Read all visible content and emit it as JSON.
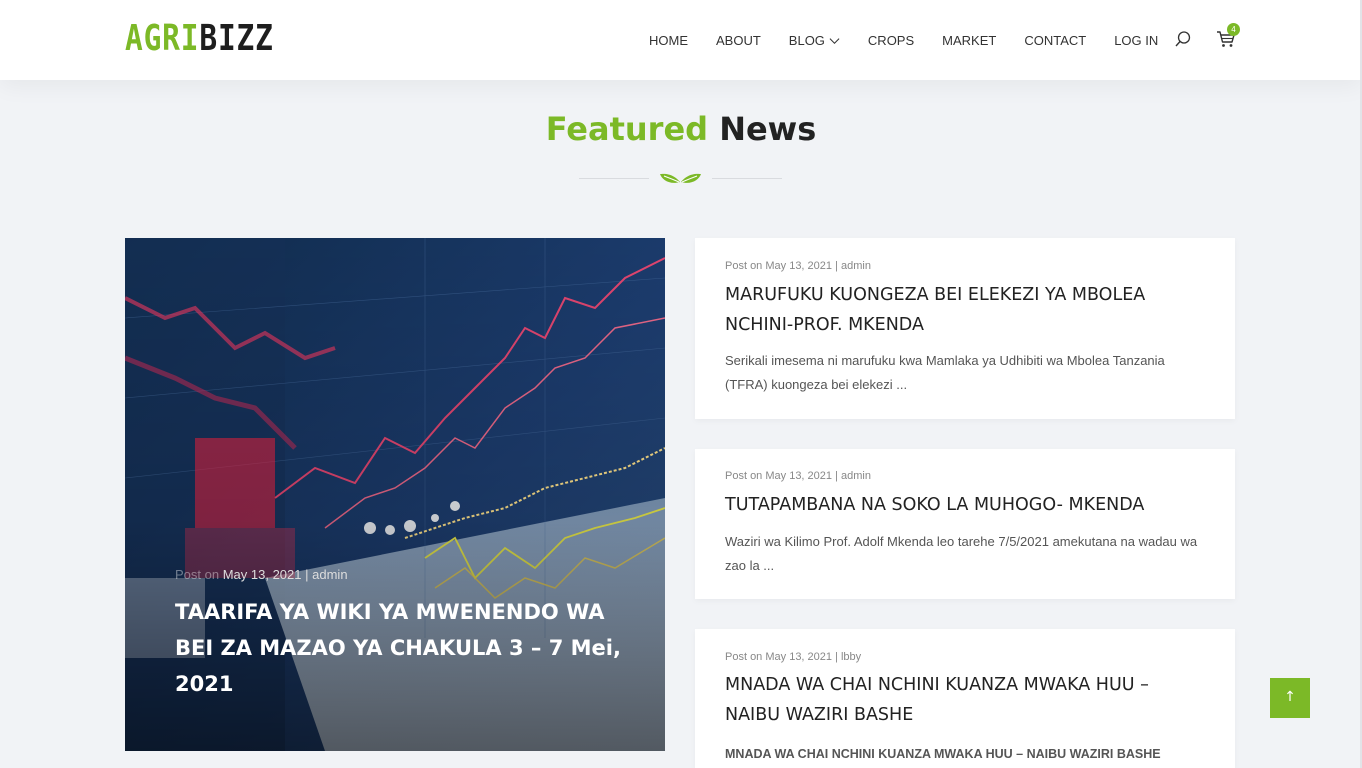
{
  "brand": {
    "part1": "AGRI",
    "part2": "BIZZ"
  },
  "nav": {
    "items": [
      "HOME",
      "ABOUT",
      "BLOG",
      "CROPS",
      "MARKET",
      "CONTACT",
      "LOG IN"
    ]
  },
  "cart": {
    "count": "4"
  },
  "section": {
    "title_green": "Featured",
    "title_dark": "News"
  },
  "hero": {
    "meta_prefix": "Post on",
    "date": "May 13, 2021",
    "sep": "|",
    "author": "admin",
    "title": "TAARIFA YA WIKI YA MWENENDO WA BEI ZA MAZAO YA CHAKULA 3 – 7 Mei, 2021"
  },
  "cards": [
    {
      "meta": "Post on May 13, 2021 | admin",
      "title": "MARUFUKU KUONGEZA BEI ELEKEZI YA MBOLEA NCHINI-PROF. MKENDA",
      "excerpt": " Serikali imesema ni marufuku kwa Mamlaka ya Udhibiti wa Mbolea Tanzania (TFRA) kuongeza bei elekezi ..."
    },
    {
      "meta": "Post on May 13, 2021 | admin",
      "title": "TUTAPAMBANA NA SOKO LA MUHOGO- MKENDA",
      "excerpt": "Waziri wa Kilimo Prof. Adolf Mkenda leo tarehe 7/5/2021  amekutana na wadau wa zao la ..."
    },
    {
      "meta": "Post on May 13, 2021 | lbby",
      "title": "MNADA WA CHAI NCHINI KUANZA MWAKA HUU – NAIBU WAZIRI BASHE",
      "excerpt": "MNADA WA CHAI NCHINI KUANZA MWAKA HUU – NAIBU WAZIRI BASHE"
    }
  ],
  "back_to_top": {
    "label": "↑"
  },
  "colors": {
    "accent": "#7cb927",
    "dark": "#222222",
    "background": "#f1f3f6"
  }
}
